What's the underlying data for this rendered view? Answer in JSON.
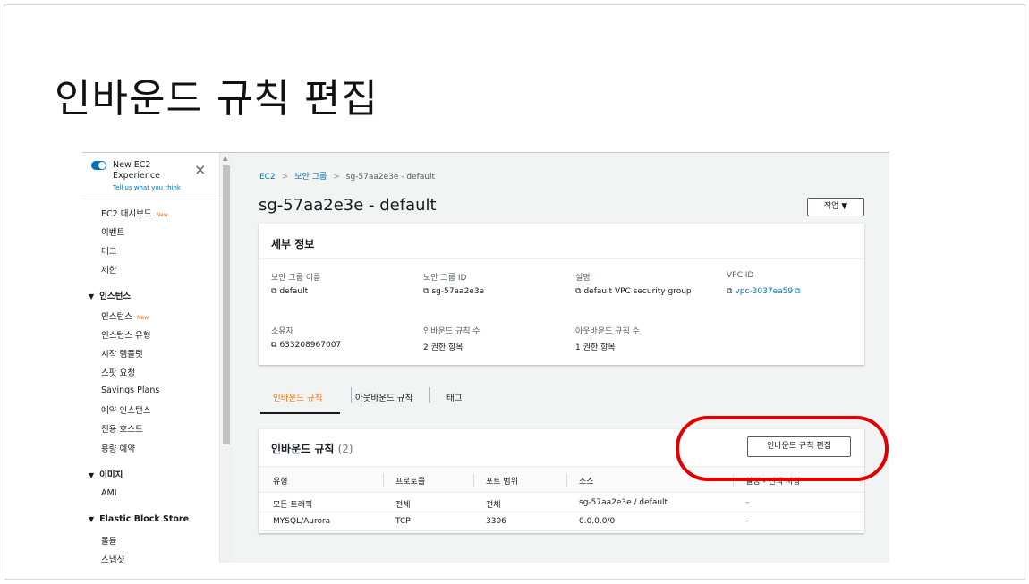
{
  "slide": {
    "title": "인바운드 규칙 편집"
  },
  "sidebar": {
    "experience": {
      "title": "New EC2 Experience",
      "link": "Tell us what you think",
      "close": "×"
    },
    "items": [
      {
        "label": "EC2 대시보드",
        "badge": "New"
      },
      {
        "label": "이벤트"
      },
      {
        "label": "태그"
      },
      {
        "label": "제한"
      }
    ],
    "sections": [
      {
        "label": "인스턴스",
        "items": [
          {
            "label": "인스턴스",
            "badge": "New"
          },
          {
            "label": "인스턴스 유형"
          },
          {
            "label": "시작 템플릿"
          },
          {
            "label": "스팟 요청"
          },
          {
            "label": "Savings Plans"
          },
          {
            "label": "예약 인스턴스"
          },
          {
            "label": "전용 호스트"
          },
          {
            "label": "용량 예약"
          }
        ]
      },
      {
        "label": "이미지",
        "items": [
          {
            "label": "AMI"
          }
        ]
      },
      {
        "label": "Elastic Block Store",
        "items": [
          {
            "label": "볼륨"
          },
          {
            "label": "스냅샷"
          }
        ]
      }
    ]
  },
  "breadcrumb": {
    "root": "EC2",
    "parent": "보안 그룹",
    "current": "sg-57aa2e3e - default"
  },
  "page": {
    "title": "sg-57aa2e3e - default",
    "actions_label": "작업 ▼"
  },
  "details": {
    "heading": "세부 정보",
    "fields": [
      {
        "label": "보안 그룹 이름",
        "value": "default"
      },
      {
        "label": "보안 그룹 ID",
        "value": "sg-57aa2e3e"
      },
      {
        "label": "설명",
        "value": "default VPC security group"
      },
      {
        "label": "VPC ID",
        "value": "vpc-3037ea59"
      },
      {
        "label": "소유자",
        "value": "633208967007"
      },
      {
        "label": "인바운드 규칙 수",
        "value": "2 권한 항목"
      },
      {
        "label": "아웃바운드 규칙 수",
        "value": "1 권한 항목"
      }
    ]
  },
  "tabs": [
    {
      "label": "인바운드 규칙"
    },
    {
      "label": "아웃바운드 규칙"
    },
    {
      "label": "태그"
    }
  ],
  "rules": {
    "title": "인바운드 규칙",
    "count": "(2)",
    "edit_label": "인바운드 규칙 편집",
    "columns": [
      "유형",
      "프로토콜",
      "포트 범위",
      "소스",
      "설명 - 선택 사항"
    ],
    "rows": [
      [
        "모든 트래픽",
        "전체",
        "전체",
        "sg-57aa2e3e / default",
        "–"
      ],
      [
        "MYSQL/Aurora",
        "TCP",
        "3306",
        "0.0.0.0/0",
        "–"
      ]
    ]
  },
  "colors": {
    "link": "#0073bb",
    "accent": "#ec7211",
    "highlight": "#e00000"
  }
}
